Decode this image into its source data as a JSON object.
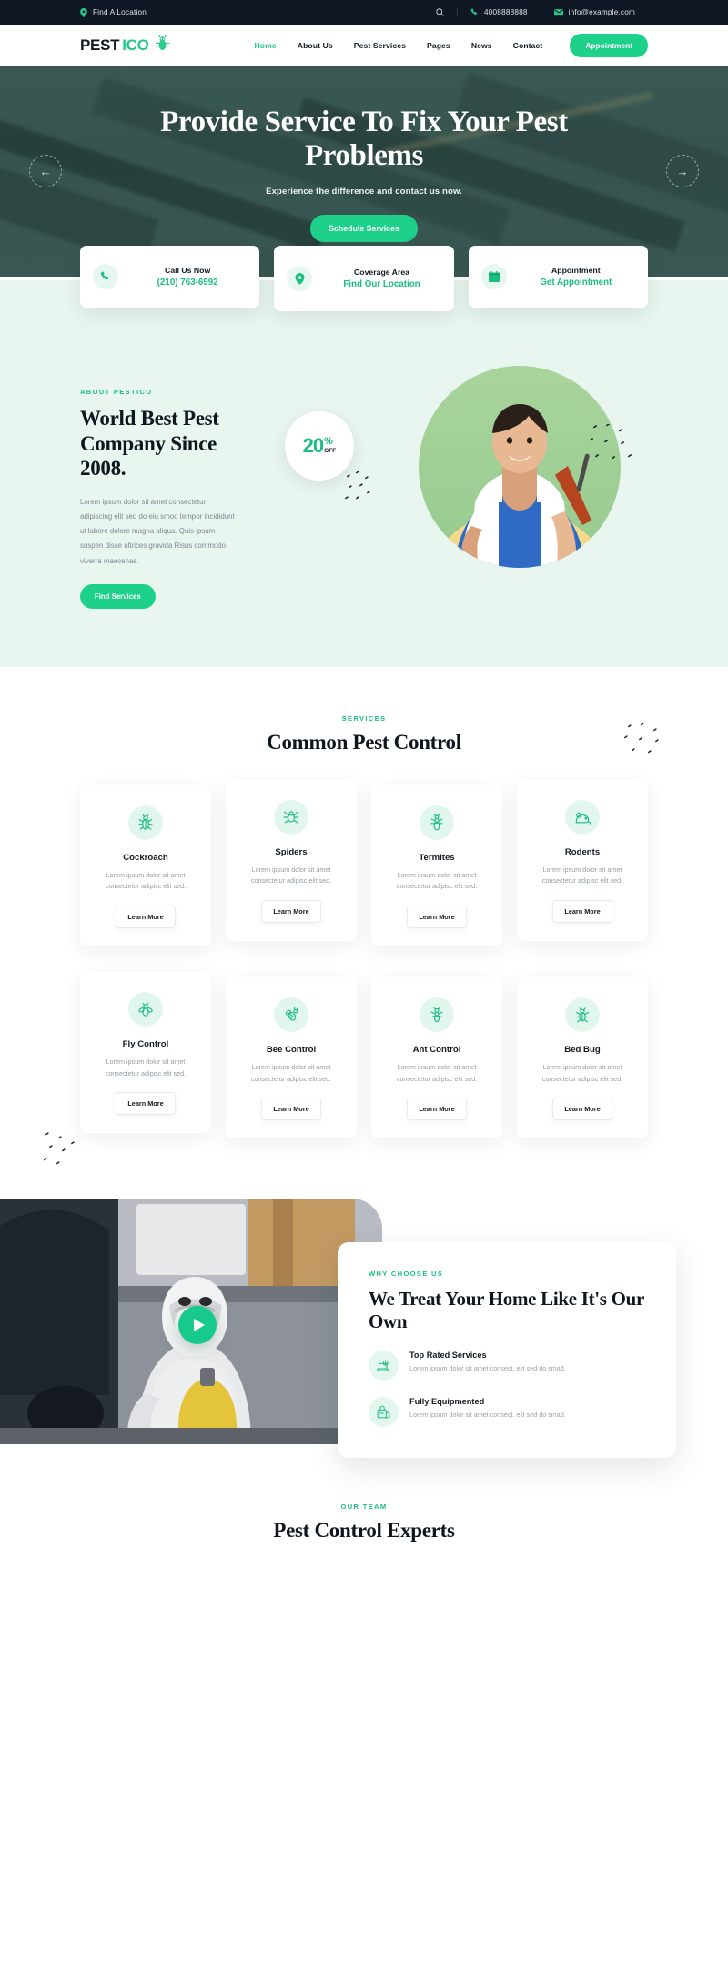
{
  "topbar": {
    "location_label": "Find A Location",
    "location_icon": "map-pin-icon",
    "search_icon": "search-icon",
    "phone_icon": "phone-icon",
    "phone": "4008888888",
    "email_icon": "envelope-icon",
    "email": "info@example.com"
  },
  "header": {
    "logo_part1": "PEST",
    "logo_part2": "ICO",
    "logo_icon": "bug-mascot-icon",
    "nav": [
      {
        "label": "Home",
        "active": true
      },
      {
        "label": "About Us",
        "active": false
      },
      {
        "label": "Pest Services",
        "active": false
      },
      {
        "label": "Pages",
        "active": false
      },
      {
        "label": "News",
        "active": false
      },
      {
        "label": "Contact",
        "active": false
      }
    ],
    "appointment_label": "Appointment"
  },
  "hero": {
    "title": "Provide Service To Fix Your Pest Problems",
    "subtitle": "Experience the difference and contact us now.",
    "cta_label": "Schedule Services",
    "prev_icon": "arrow-left-icon",
    "next_icon": "arrow-right-icon"
  },
  "info_cards": [
    {
      "icon": "phone-icon",
      "title": "Call Us Now",
      "value": "(210) 763-6992"
    },
    {
      "icon": "map-pin-icon",
      "title": "Coverage Area",
      "value": "Find Our Location"
    },
    {
      "icon": "calendar-icon",
      "title": "Appointment",
      "value": "Get Appointment"
    }
  ],
  "about": {
    "eyebrow": "ABOUT PESTICO",
    "title": "World Best Pest Company Since 2008.",
    "body": "Lorem ipsum dolor sit amet consectetur adipiscing elit sed do eiu smod tempor incididunt ut labore dolore magna aliqua. Quis ipsum suspen disse ultrices gravida Risus commodo viverra maecenas.",
    "cta_label": "Find Services",
    "badge_number": "20",
    "badge_percent": "%",
    "badge_off": "OFF"
  },
  "services": {
    "eyebrow": "SERVICES",
    "title": "Common Pest Control",
    "learn_more_label": "Learn More",
    "desc": "Lorem ipsum dolor sit amet consectetur adipisc elit sed.",
    "items": [
      {
        "icon": "cockroach-icon",
        "name": "Cockroach"
      },
      {
        "icon": "spider-icon",
        "name": "Spiders"
      },
      {
        "icon": "termite-icon",
        "name": "Termites"
      },
      {
        "icon": "rodent-icon",
        "name": "Rodents"
      },
      {
        "icon": "fly-icon",
        "name": "Fly Control"
      },
      {
        "icon": "bee-icon",
        "name": "Bee Control"
      },
      {
        "icon": "ant-icon",
        "name": "Ant Control"
      },
      {
        "icon": "bedbug-icon",
        "name": "Bed Bug"
      }
    ]
  },
  "why": {
    "eyebrow": "WHY CHOOSE US",
    "title": "We Treat Your Home Like It's Our Own",
    "play_icon": "play-button-icon",
    "features": [
      {
        "icon": "top-rated-icon",
        "title": "Top Rated Services",
        "text": "Lorem ipsum dolor sit amet consect. elit sed do smad."
      },
      {
        "icon": "equipment-icon",
        "title": "Fully Equipmented",
        "text": "Lorem ipsum dolor sit amet consect. elit sed do smad."
      }
    ]
  },
  "team": {
    "eyebrow": "OUR TEAM",
    "title": "Pest Control Experts"
  },
  "colors": {
    "accent": "#1ED18B",
    "accent_dark": "#1BBE80",
    "dark": "#0F1724",
    "about_bg": "#E9F6F0"
  }
}
